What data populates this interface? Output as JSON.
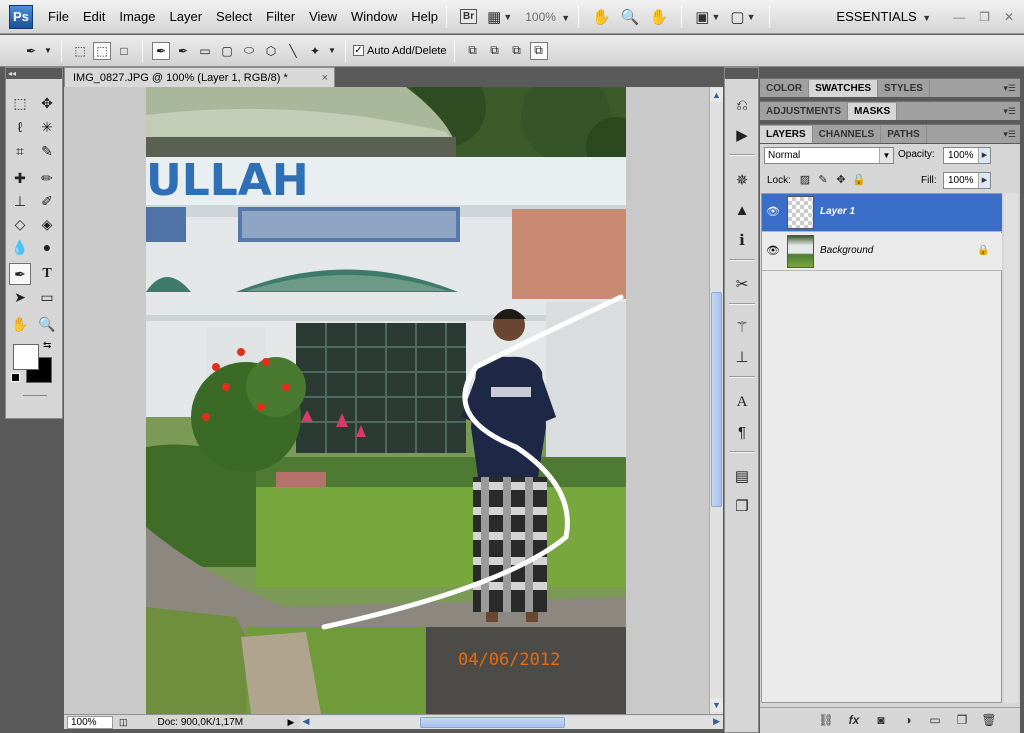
{
  "app": {
    "logo": "Ps",
    "workspace": "ESSENTIALS"
  },
  "menu": [
    "File",
    "Edit",
    "Image",
    "Layer",
    "Select",
    "Filter",
    "View",
    "Window",
    "Help"
  ],
  "appbar": {
    "bridge_label": "Br",
    "zoom": "100%"
  },
  "options": {
    "auto_add_label": "Auto Add/Delete",
    "auto_add_checked": "✓"
  },
  "document": {
    "tab_title": "IMG_0827.JPG @ 100% (Layer 1, RGB/8) *",
    "close": "×",
    "photo_date": "04/06/2012",
    "sign_text": "ULLAH"
  },
  "status": {
    "zoom": "100%",
    "doc_info": "Doc: 900,0K/1,17M"
  },
  "panels": {
    "group1": [
      "COLOR",
      "SWATCHES",
      "STYLES"
    ],
    "group1_active": "SWATCHES",
    "group2": [
      "ADJUSTMENTS",
      "MASKS"
    ],
    "group2_active": "MASKS",
    "group3": [
      "LAYERS",
      "CHANNELS",
      "PATHS"
    ],
    "group3_active": "LAYERS"
  },
  "layers_panel": {
    "blend_mode": "Normal",
    "opacity_label": "Opacity:",
    "opacity": "100%",
    "lock_label": "Lock:",
    "fill_label": "Fill:",
    "fill": "100%",
    "layers": [
      {
        "name": "Layer 1",
        "selected": true
      },
      {
        "name": "Background",
        "selected": false,
        "locked": true
      }
    ]
  },
  "icons": {
    "eye": "eye-icon",
    "lock": "lock-icon",
    "move": "move-tool-icon",
    "pen": "pen-tool-icon"
  },
  "colors": {
    "selection_blue": "#3b6ec9",
    "date_orange": "#e86a10",
    "panel_grey": "#d6d6d6"
  }
}
